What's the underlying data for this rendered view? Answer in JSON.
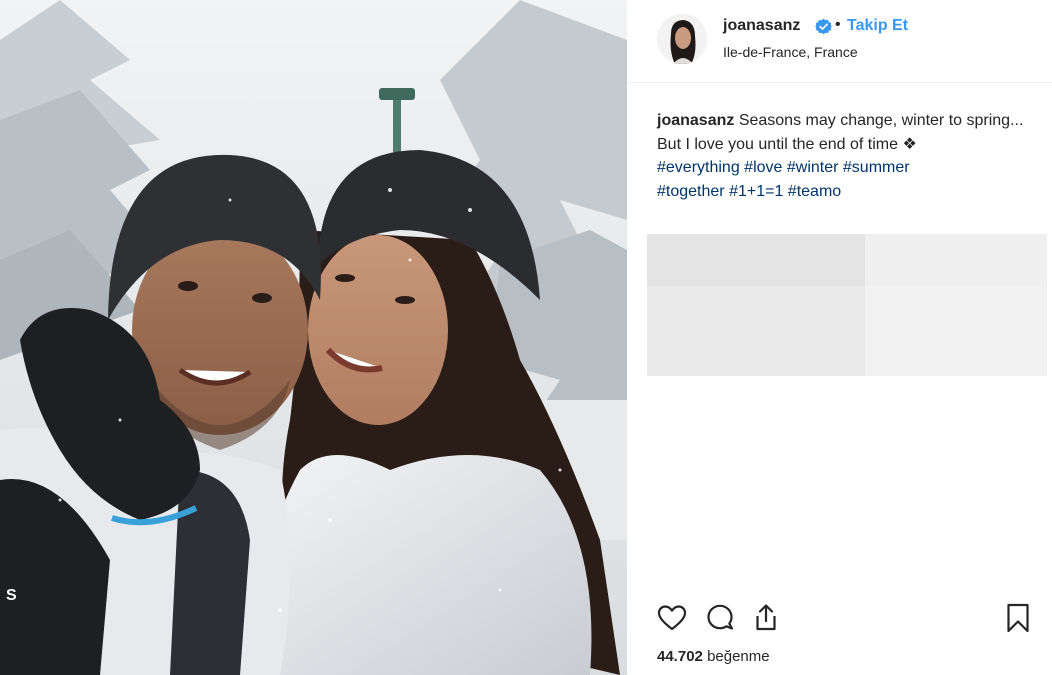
{
  "post": {
    "username": "joanasanz",
    "separator": "•",
    "follow_label": "Takip Et",
    "location": "Ile-de-France, France",
    "caption": {
      "username": "joanasanz",
      "line1": "Seasons may change, winter to spring...",
      "line2": "But I love you until the end of time ❖",
      "hashtags_line1": [
        "#everything",
        "#love",
        "#winter",
        "#summer"
      ],
      "hashtags_line2": [
        "#together",
        "#1+1=1",
        "#teamo"
      ]
    },
    "likes": {
      "count": "44.702",
      "label": "beğenme"
    },
    "icons": {
      "verified": "verified-badge-icon",
      "like": "heart-icon",
      "comment": "comment-icon",
      "share": "share-icon",
      "save": "bookmark-icon"
    },
    "colors": {
      "link_blue": "#3897f0",
      "hashtag": "#003569",
      "text": "#262626"
    }
  }
}
